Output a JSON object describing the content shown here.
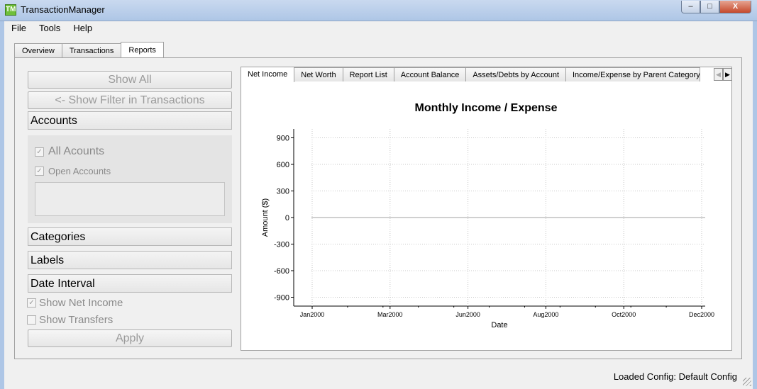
{
  "window": {
    "title": "TransactionManager",
    "icon_text": "TM",
    "minimize": "–",
    "maximize": "□",
    "close": "X"
  },
  "menu": [
    "File",
    "Tools",
    "Help"
  ],
  "main_tabs": [
    {
      "label": "Overview",
      "active": false
    },
    {
      "label": "Transactions",
      "active": false
    },
    {
      "label": "Reports",
      "active": true
    }
  ],
  "filter": {
    "show_all": "Show All",
    "show_filter": "<- Show Filter in Transactions",
    "accounts_header": "Accounts",
    "all_accounts": "All Acounts",
    "open_accounts": "Open Accounts",
    "categories_header": "Categories",
    "labels_header": "Labels",
    "date_interval_header": "Date Interval",
    "show_net_income": "Show Net Income",
    "show_transfers": "Show Transfers",
    "apply": "Apply"
  },
  "report_tabs": [
    {
      "label": "Net Income",
      "active": true
    },
    {
      "label": "Net Worth",
      "active": false
    },
    {
      "label": "Report List",
      "active": false
    },
    {
      "label": "Account Balance",
      "active": false
    },
    {
      "label": "Assets/Debts by Account",
      "active": false
    },
    {
      "label": "Income/Expense by Parent Category",
      "active": false
    }
  ],
  "chart_data": {
    "type": "line",
    "title": "Monthly Income / Expense",
    "xlabel": "Date",
    "ylabel": "Amount ($)",
    "x_ticks": [
      "Jan2000",
      "Mar2000",
      "Jun2000",
      "Aug2000",
      "Oct2000",
      "Dec2000"
    ],
    "y_ticks": [
      900,
      600,
      300,
      0,
      -300,
      -600,
      -900
    ],
    "ylim": [
      -1000,
      1000
    ],
    "grid": true,
    "series": []
  },
  "status": "Loaded Config: Default Config"
}
